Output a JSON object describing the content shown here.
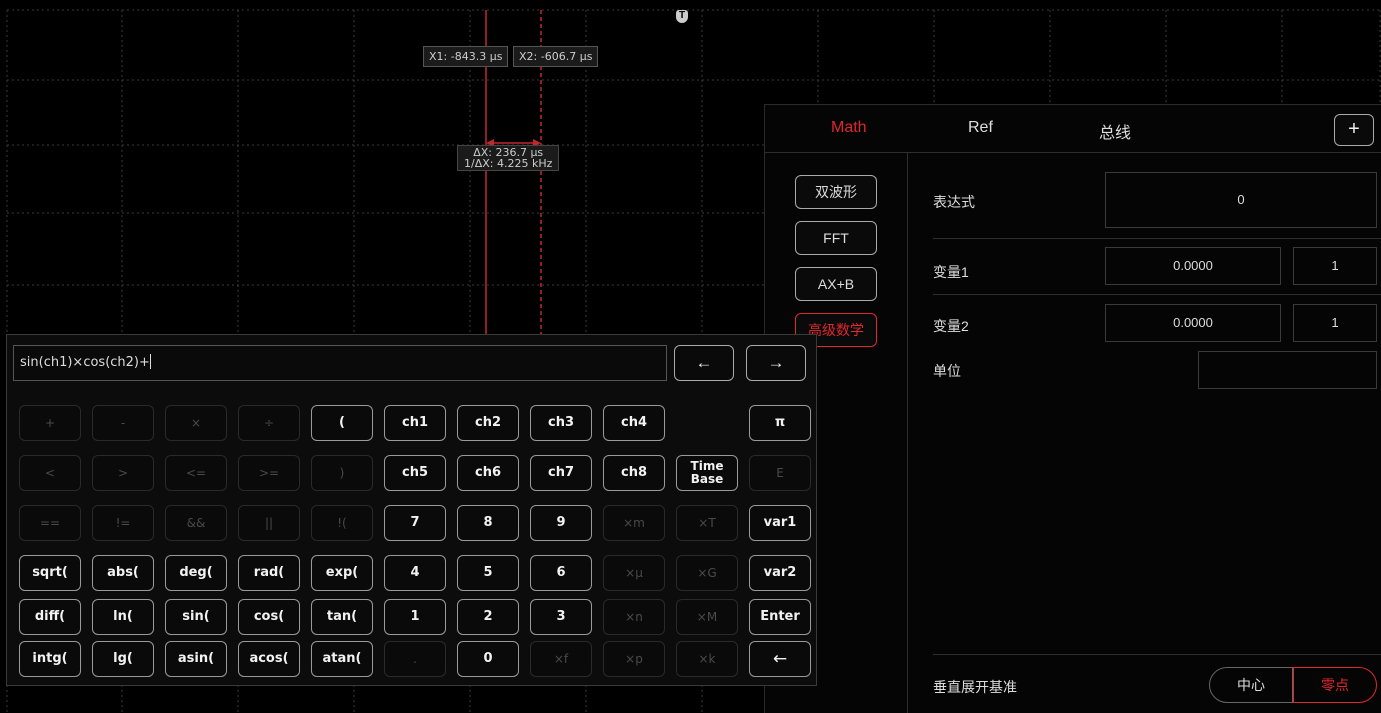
{
  "scope": {
    "trigger_marker": "T",
    "cursor_x1": "X1: -843.3 µs",
    "cursor_x2": "X2: -606.7 µs",
    "delta_x": "ΔX: 236.7 µs",
    "inv_delta_x": "1/ΔX: 4.225 kHz",
    "colors": {
      "cursor": "#c0282e",
      "grid": "#3a3a3a"
    }
  },
  "panel": {
    "tabs": [
      {
        "label": "Math",
        "active": true
      },
      {
        "label": "Ref",
        "active": false
      },
      {
        "label": "总线",
        "active": false
      }
    ],
    "add_button": "+",
    "modes": [
      {
        "label": "双波形",
        "active": false
      },
      {
        "label": "FFT",
        "active": false
      },
      {
        "label": "AX+B",
        "active": false
      },
      {
        "label": "高级数学",
        "active": true
      }
    ],
    "expression": {
      "label": "表达式",
      "value": "0"
    },
    "var1": {
      "label": "变量1",
      "value": "0.0000",
      "unit_value": "1"
    },
    "var2": {
      "label": "变量2",
      "value": "0.0000",
      "unit_value": "1"
    },
    "unit": {
      "label": "单位",
      "value": ""
    },
    "vertical_expand": {
      "label": "垂直展开基准",
      "options": [
        "中心",
        "零点"
      ],
      "selected": "零点"
    }
  },
  "keyboard": {
    "expression": "sin(ch1)×cos(ch2)+",
    "nav_left": "←",
    "nav_right": "→",
    "rows": [
      [
        {
          "label": "+",
          "enabled": false
        },
        {
          "label": "-",
          "enabled": false
        },
        {
          "label": "×",
          "enabled": false
        },
        {
          "label": "÷",
          "enabled": false
        },
        {
          "label": "(",
          "enabled": true
        },
        {
          "label": "ch1",
          "enabled": true
        },
        {
          "label": "ch2",
          "enabled": true
        },
        {
          "label": "ch3",
          "enabled": true
        },
        {
          "label": "ch4",
          "enabled": true
        },
        null,
        {
          "label": "π",
          "enabled": true
        }
      ],
      [
        {
          "label": "<",
          "enabled": false
        },
        {
          "label": ">",
          "enabled": false
        },
        {
          "label": "<=",
          "enabled": false
        },
        {
          "label": ">=",
          "enabled": false
        },
        {
          "label": ")",
          "enabled": false
        },
        {
          "label": "ch5",
          "enabled": true
        },
        {
          "label": "ch6",
          "enabled": true
        },
        {
          "label": "ch7",
          "enabled": true
        },
        {
          "label": "ch8",
          "enabled": true
        },
        {
          "label": "Time Base",
          "enabled": true
        },
        {
          "label": "E",
          "enabled": false
        }
      ],
      [
        {
          "label": "==",
          "enabled": false
        },
        {
          "label": "!=",
          "enabled": false
        },
        {
          "label": "&&",
          "enabled": false
        },
        {
          "label": "||",
          "enabled": false
        },
        {
          "label": "!(",
          "enabled": false
        },
        {
          "label": "7",
          "enabled": true
        },
        {
          "label": "8",
          "enabled": true
        },
        {
          "label": "9",
          "enabled": true
        },
        {
          "label": "×m",
          "enabled": false
        },
        {
          "label": "×T",
          "enabled": false
        },
        {
          "label": "var1",
          "enabled": true
        }
      ],
      [
        {
          "label": "sqrt(",
          "enabled": true
        },
        {
          "label": "abs(",
          "enabled": true
        },
        {
          "label": "deg(",
          "enabled": true
        },
        {
          "label": "rad(",
          "enabled": true
        },
        {
          "label": "exp(",
          "enabled": true
        },
        {
          "label": "4",
          "enabled": true
        },
        {
          "label": "5",
          "enabled": true
        },
        {
          "label": "6",
          "enabled": true
        },
        {
          "label": "×μ",
          "enabled": false
        },
        {
          "label": "×G",
          "enabled": false
        },
        {
          "label": "var2",
          "enabled": true
        }
      ],
      [
        {
          "label": "diff(",
          "enabled": true
        },
        {
          "label": "ln(",
          "enabled": true
        },
        {
          "label": "sin(",
          "enabled": true
        },
        {
          "label": "cos(",
          "enabled": true
        },
        {
          "label": "tan(",
          "enabled": true
        },
        {
          "label": "1",
          "enabled": true
        },
        {
          "label": "2",
          "enabled": true
        },
        {
          "label": "3",
          "enabled": true
        },
        {
          "label": "×n",
          "enabled": false
        },
        {
          "label": "×M",
          "enabled": false
        },
        {
          "label": "Enter",
          "enabled": true
        }
      ],
      [
        {
          "label": "intg(",
          "enabled": true
        },
        {
          "label": "lg(",
          "enabled": true
        },
        {
          "label": "asin(",
          "enabled": true
        },
        {
          "label": "acos(",
          "enabled": true
        },
        {
          "label": "atan(",
          "enabled": true
        },
        {
          "label": ".",
          "enabled": false
        },
        {
          "label": "0",
          "enabled": true
        },
        {
          "label": "×f",
          "enabled": false
        },
        {
          "label": "×p",
          "enabled": false
        },
        {
          "label": "×k",
          "enabled": false
        },
        {
          "label": "←",
          "enabled": true
        }
      ]
    ]
  }
}
